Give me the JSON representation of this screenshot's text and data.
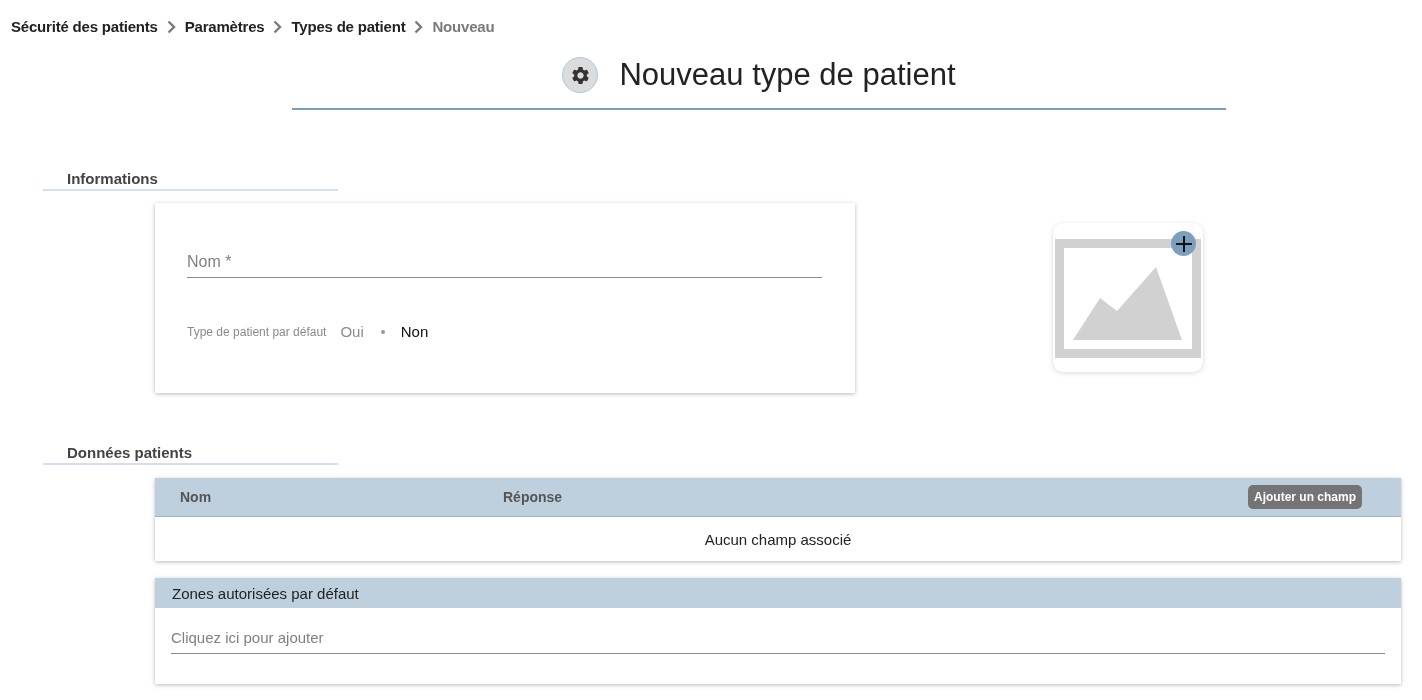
{
  "breadcrumb": [
    {
      "label": "Sécurité des patients",
      "current": false
    },
    {
      "label": "Paramètres",
      "current": false
    },
    {
      "label": "Types de patient",
      "current": false
    },
    {
      "label": "Nouveau",
      "current": true
    }
  ],
  "title": "Nouveau type de patient",
  "informations": {
    "heading": "Informations",
    "name_field": {
      "placeholder": "Nom *"
    },
    "default_type": {
      "label": "Type de patient par défaut",
      "options": [
        {
          "label": "Oui",
          "selected": false
        },
        {
          "label": "Non",
          "selected": true
        }
      ]
    }
  },
  "patient_data": {
    "heading": "Données patients",
    "columns": [
      "Nom",
      "Réponse"
    ],
    "add_button": "Ajouter un champ",
    "empty_message": "Aucun champ associé"
  },
  "default_zones": {
    "title": "Zones autorisées par défaut",
    "field": {
      "placeholder": "Cliquez ici pour ajouter"
    }
  }
}
